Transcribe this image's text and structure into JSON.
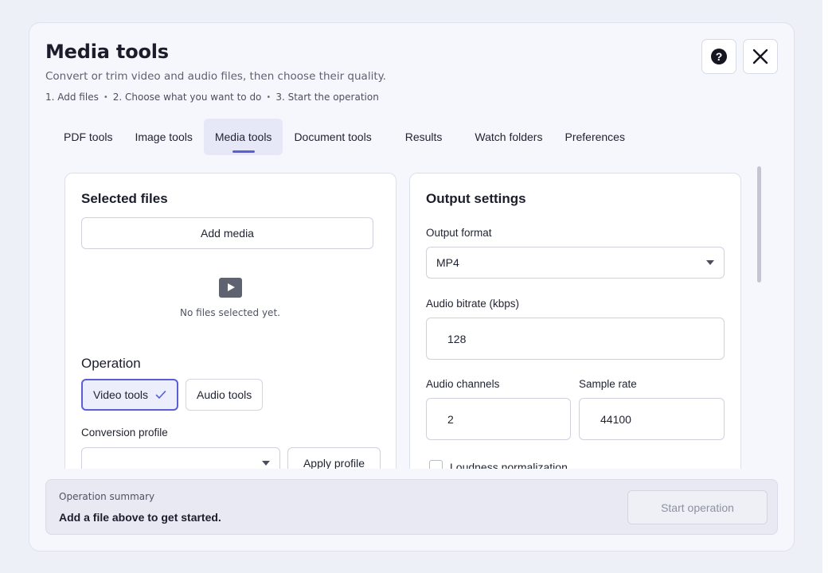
{
  "dialog": {
    "title": "Media tools",
    "subtitle": "Convert or trim video and audio files, then choose their quality.",
    "steps": [
      "1. Add files",
      "2. Choose what you want to do",
      "3. Start the operation"
    ],
    "help_icon": "help-circle-icon",
    "close_icon": "close-icon"
  },
  "tabs": [
    {
      "label": "PDF tools",
      "active": false
    },
    {
      "label": "Image tools",
      "active": false
    },
    {
      "label": "Media tools",
      "active": true
    },
    {
      "label": "Document tools",
      "active": false
    },
    {
      "label": "Results",
      "active": false
    },
    {
      "label": "Watch folders",
      "active": false
    },
    {
      "label": "Preferences",
      "active": false
    }
  ],
  "selected_files": {
    "heading": "Selected files",
    "add_button": "Add media",
    "empty_icon": "play-icon",
    "empty_text": "No files selected yet."
  },
  "operation": {
    "heading": "Operation",
    "options": [
      {
        "label": "Video tools",
        "selected": true
      },
      {
        "label": "Audio tools",
        "selected": false
      }
    ],
    "profile_label": "Conversion profile",
    "profile_value": "",
    "apply_button": "Apply profile"
  },
  "output_settings": {
    "heading": "Output settings",
    "format_label": "Output format",
    "format_value": "MP4",
    "bitrate_label": "Audio bitrate (kbps)",
    "bitrate_value": "128",
    "channels_label": "Audio channels",
    "channels_value": "2",
    "sample_rate_label": "Sample rate",
    "sample_rate_value": "44100",
    "loudness_label": "Loudness normalization",
    "loudness_checked": false
  },
  "summary": {
    "label": "Operation summary",
    "text": "Add a file above to get started.",
    "start_button": "Start operation"
  },
  "colors": {
    "accent": "#5b5fd6",
    "background": "#eef0f7",
    "panel": "#ffffff"
  }
}
